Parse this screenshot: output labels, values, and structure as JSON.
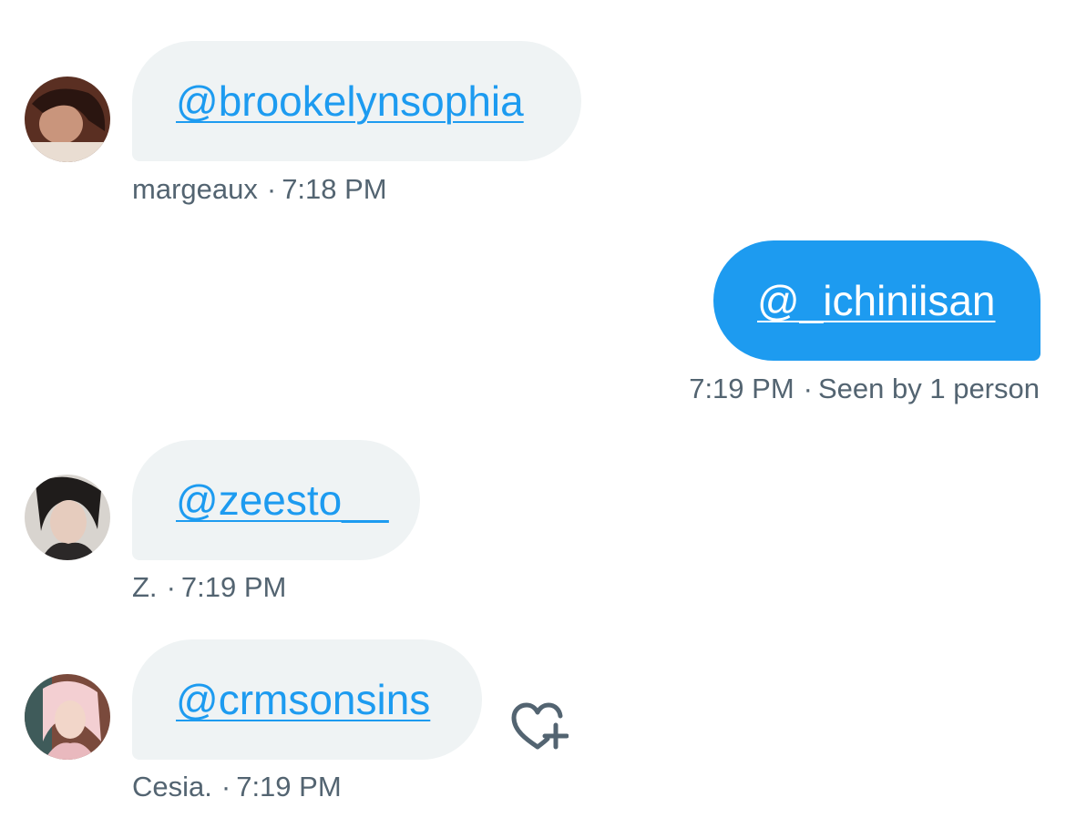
{
  "messages": [
    {
      "direction": "incoming",
      "mention": "@brookelynsophia",
      "sender": "margeaux",
      "separator": "·",
      "time": "7:18 PM"
    },
    {
      "direction": "outgoing",
      "mention": "@_ichiniisan",
      "time": "7:19 PM",
      "separator": "·",
      "status": "Seen by 1 person"
    },
    {
      "direction": "incoming",
      "mention": "@zeesto__",
      "sender": "Z.",
      "separator": "·",
      "time": "7:19 PM"
    },
    {
      "direction": "incoming",
      "mention": "@crmsonsins",
      "sender": "Cesia.",
      "separator": "·",
      "time": "7:19 PM"
    }
  ],
  "icons": {
    "react": "heart-plus-icon",
    "avatar": "avatar"
  },
  "colors": {
    "accent": "#1d9bf0",
    "incoming_bubble": "#eff3f4",
    "meta_text": "#536471"
  }
}
